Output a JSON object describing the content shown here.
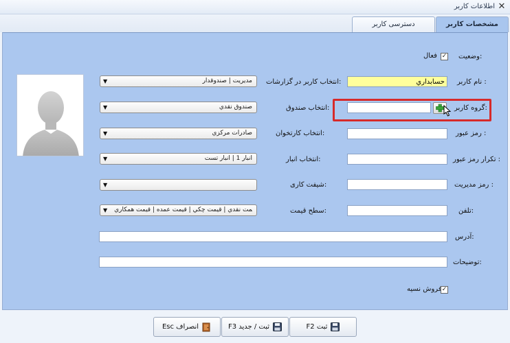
{
  "window": {
    "title": "اطلاعات کاربر",
    "close_symbol": "✕"
  },
  "tabs": [
    {
      "label": "مشخصات کاربر",
      "active": true
    },
    {
      "label": "دسترسی کاربر",
      "active": false
    }
  ],
  "form": {
    "status_label": "وضعیت:",
    "active_checkbox_label": "فعال",
    "active_checked": true,
    "username_label": "نام کاربر :",
    "username_value": "حسابداري",
    "user_group_label": "گروه کاربر:",
    "user_group_value": "",
    "password_label": "رمز عبور :",
    "password_repeat_label": "تکرار رمز عبور :",
    "admin_password_label": "رمز مدیریت :",
    "phone_label": "تلفن:",
    "address_label": "آدرس:",
    "description_label": "توضیحات:",
    "report_user_label": "انتخاب کاربر در گزارشات:",
    "report_user_value": "مديريت | صندوقدار",
    "cashbox_label": "انتخاب صندوق:",
    "cashbox_value": "صندوق نقدي",
    "cartable_label": "انتخاب کارتخوان:",
    "cartable_value": "صادرات مرکزي",
    "warehouse_label": "انتخاب انبار:",
    "warehouse_value": "انبار 1 | انبار تست",
    "shift_label": "شیفت کاری:",
    "shift_value": "",
    "price_level_label": "سطح قیمت:",
    "price_level_value": "ﻤﺖ نقدي | قيمت چکي | قيمت عمده | قيمت همکاري",
    "credit_sale_label": "فروش نسیه",
    "credit_sale_checked": true
  },
  "buttons": {
    "save": "ثبت F2",
    "save_new": "ثبت / جدید F3",
    "cancel": "انصراف Esc"
  },
  "colors": {
    "panel": "#abc7ef",
    "highlight_field": "#ffff9c",
    "highlight_border": "#d72a2a"
  }
}
